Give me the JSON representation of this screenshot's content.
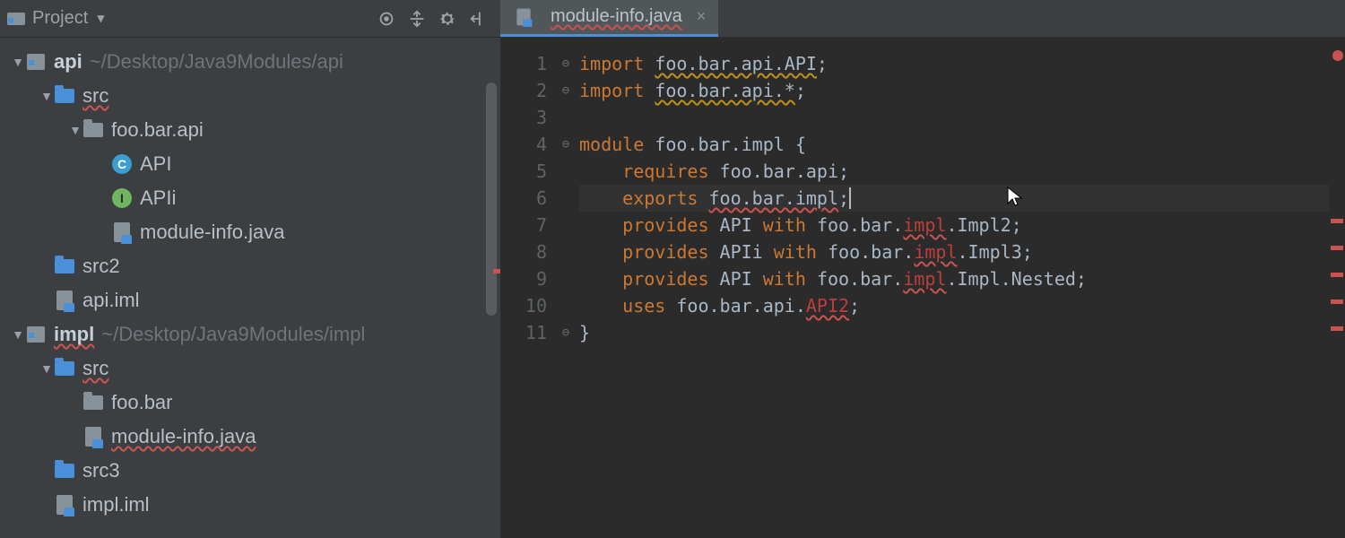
{
  "sidebar": {
    "title": "Project",
    "tree": [
      {
        "indent": 1,
        "arrow": "down",
        "icon": "module",
        "label": "api",
        "bold": true,
        "path": "~/Desktop/Java9Modules/api",
        "err": false
      },
      {
        "indent": 2,
        "arrow": "down",
        "icon": "folder-blue",
        "label": "src",
        "err": "err"
      },
      {
        "indent": 3,
        "arrow": "down",
        "icon": "folder-grey",
        "label": "foo.bar.api"
      },
      {
        "indent": 4,
        "arrow": "blank",
        "icon": "class-c",
        "label": "API"
      },
      {
        "indent": 4,
        "arrow": "blank",
        "icon": "class-i",
        "label": "APIi"
      },
      {
        "indent": 4,
        "arrow": "blank",
        "icon": "java-file",
        "label": "module-info.java"
      },
      {
        "indent": 2,
        "arrow": "blank",
        "icon": "folder-blue",
        "label": "src2"
      },
      {
        "indent": 2,
        "arrow": "blank",
        "icon": "java-file",
        "label": "api.iml"
      },
      {
        "indent": 1,
        "arrow": "down",
        "icon": "module",
        "label": "impl",
        "bold": true,
        "path": "~/Desktop/Java9Modules/impl",
        "err": "err"
      },
      {
        "indent": 2,
        "arrow": "down",
        "icon": "folder-blue",
        "label": "src",
        "err": "err"
      },
      {
        "indent": 3,
        "arrow": "blank",
        "icon": "folder-grey",
        "label": "foo.bar"
      },
      {
        "indent": 3,
        "arrow": "blank",
        "icon": "java-file",
        "label": "module-info.java",
        "err": "err"
      },
      {
        "indent": 2,
        "arrow": "blank",
        "icon": "folder-blue",
        "label": "src3"
      },
      {
        "indent": 2,
        "arrow": "blank",
        "icon": "java-file",
        "label": "impl.iml"
      }
    ]
  },
  "tab": {
    "label": "module-info.java",
    "err": true
  },
  "code": {
    "lines": [
      {
        "n": 1,
        "gut": "⊖",
        "tokens": [
          {
            "t": "import ",
            "c": "kw"
          },
          {
            "t": "foo.bar.api.API",
            "c": "warn"
          },
          {
            "t": ";",
            "c": "plain"
          }
        ]
      },
      {
        "n": 2,
        "gut": "⊖",
        "tokens": [
          {
            "t": "import ",
            "c": "kw"
          },
          {
            "t": "foo.bar.api.*",
            "c": "warn"
          },
          {
            "t": ";",
            "c": "plain"
          }
        ]
      },
      {
        "n": 3,
        "gut": "",
        "tokens": []
      },
      {
        "n": 4,
        "gut": "⊖",
        "tokens": [
          {
            "t": "module ",
            "c": "kw"
          },
          {
            "t": "foo.bar.impl {",
            "c": "plain"
          }
        ]
      },
      {
        "n": 5,
        "gut": "",
        "tokens": [
          {
            "t": "    requires ",
            "c": "kw"
          },
          {
            "t": "foo.bar.api;",
            "c": "plain"
          }
        ]
      },
      {
        "n": 6,
        "gut": "",
        "current": true,
        "tokens": [
          {
            "t": "    exports ",
            "c": "kw"
          },
          {
            "t": "foo.bar.impl",
            "c": "err-plain"
          },
          {
            "t": ";",
            "c": "plain"
          },
          {
            "t": "CARET"
          }
        ]
      },
      {
        "n": 7,
        "gut": "",
        "tokens": [
          {
            "t": "    provides ",
            "c": "kw"
          },
          {
            "t": "API ",
            "c": "plain"
          },
          {
            "t": "with ",
            "c": "kw"
          },
          {
            "t": "foo.bar.",
            "c": "plain"
          },
          {
            "t": "impl",
            "c": "errt"
          },
          {
            "t": ".Impl2;",
            "c": "plain"
          }
        ]
      },
      {
        "n": 8,
        "gut": "",
        "tokens": [
          {
            "t": "    provides ",
            "c": "kw"
          },
          {
            "t": "APIi ",
            "c": "plain"
          },
          {
            "t": "with ",
            "c": "kw"
          },
          {
            "t": "foo.bar.",
            "c": "plain"
          },
          {
            "t": "impl",
            "c": "errt"
          },
          {
            "t": ".Impl3;",
            "c": "plain"
          }
        ]
      },
      {
        "n": 9,
        "gut": "",
        "tokens": [
          {
            "t": "    provides ",
            "c": "kw"
          },
          {
            "t": "API ",
            "c": "plain"
          },
          {
            "t": "with ",
            "c": "kw"
          },
          {
            "t": "foo.bar.",
            "c": "plain"
          },
          {
            "t": "impl",
            "c": "errt"
          },
          {
            "t": ".Impl.Nested;",
            "c": "plain"
          }
        ]
      },
      {
        "n": 10,
        "gut": "",
        "tokens": [
          {
            "t": "    uses ",
            "c": "kw"
          },
          {
            "t": "foo.bar.api.",
            "c": "plain"
          },
          {
            "t": "API2",
            "c": "errt"
          },
          {
            "t": ";",
            "c": "plain"
          }
        ]
      },
      {
        "n": 11,
        "gut": "⊖",
        "tokens": [
          {
            "t": "}",
            "c": "plain"
          }
        ]
      }
    ]
  },
  "markers": [
    202,
    232,
    262,
    292,
    322
  ]
}
